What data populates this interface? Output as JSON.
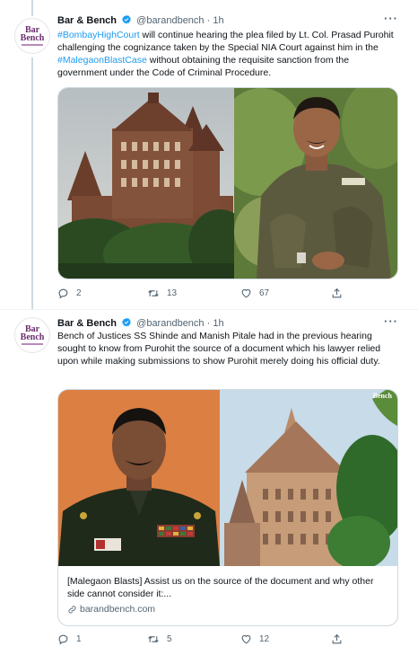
{
  "tweets": [
    {
      "avatar_line1": "Bar",
      "avatar_line2": "Bench",
      "name": "Bar & Bench",
      "handle": "@barandbench",
      "separator": "·",
      "time": "1h",
      "more": "···",
      "text_parts": {
        "hashtag1": "#BombayHighCourt",
        "t1": " will continue hearing the plea filed by Lt. Col. Prasad Purohit challenging the cognizance taken by the Special NIA Court against him in the ",
        "hashtag2": "#MalegaonBlastCase",
        "t2": " without obtaining the requisite sanction from the government under the Code of Criminal Procedure."
      },
      "replies": "2",
      "retweets": "13",
      "likes": "67"
    },
    {
      "avatar_line1": "Bar",
      "avatar_line2": "Bench",
      "name": "Bar & Bench",
      "handle": "@barandbench",
      "separator": "·",
      "time": "1h",
      "more": "···",
      "text": "Bench of Justices SS Shinde and Manish Pitale had in the previous hearing sought to know from Purohit the source of a document which his lawyer relied upon while making submissions to show Purohit merely doing his official duty.",
      "card": {
        "watermark": "Bench",
        "title": "[Malegaon Blasts] Assist us on the source of the document and why other side cannot consider it:...",
        "domain": "barandbench.com"
      },
      "replies": "1",
      "retweets": "5",
      "likes": "12"
    }
  ],
  "colors": {
    "link": "#1d9bf0",
    "secondary_text": "#536471",
    "verified": "#1d9bf0",
    "brand": "#6a2d6f"
  },
  "icons": [
    "more-icon",
    "verified-icon",
    "reply-icon",
    "retweet-icon",
    "like-icon",
    "share-icon",
    "link-icon"
  ]
}
